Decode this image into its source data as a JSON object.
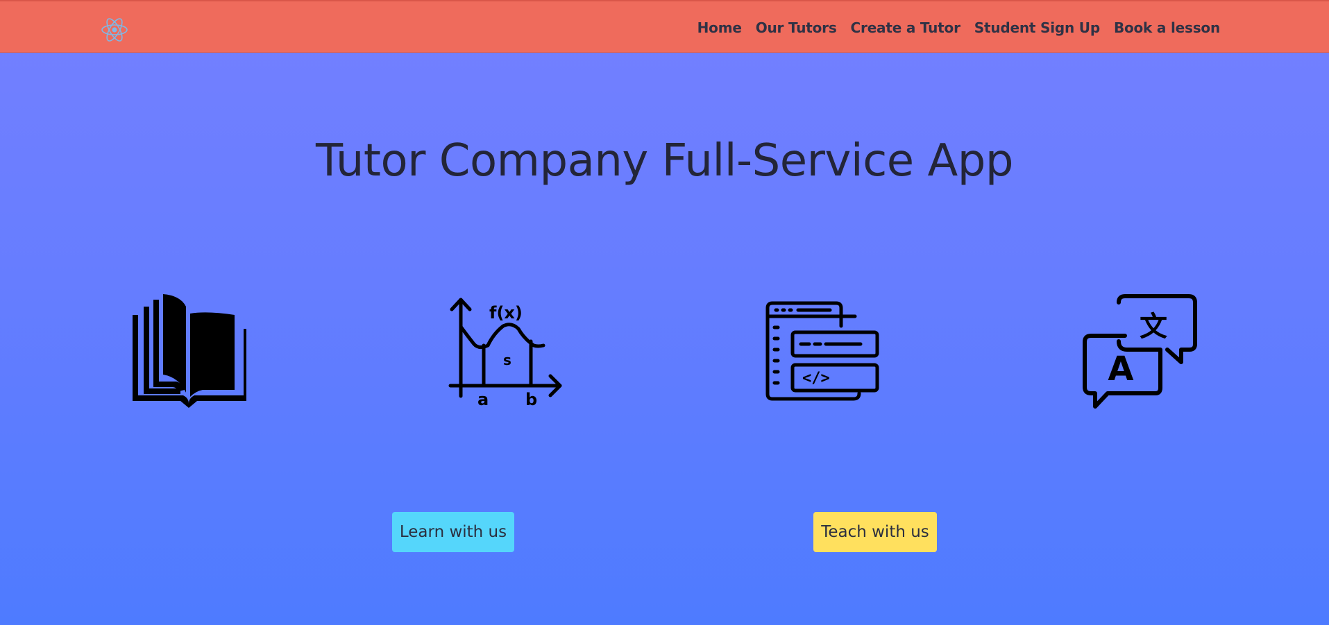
{
  "nav": {
    "brand_icon": "react-atom-icon",
    "links": [
      "Home",
      "Our Tutors",
      "Create a Tutor",
      "Student Sign Up",
      "Book a lesson"
    ]
  },
  "hero": {
    "title": "Tutor Company Full-Service App"
  },
  "subjects": [
    {
      "icon": "open-book-icon"
    },
    {
      "icon": "math-function-graph-icon",
      "labels": {
        "fx": "f(x)",
        "s": "s",
        "a": "a",
        "b": "b"
      }
    },
    {
      "icon": "code-window-icon",
      "code_tag": "</>"
    },
    {
      "icon": "translation-bubbles-icon",
      "labels": {
        "latin": "A",
        "cjk": "文"
      }
    }
  ],
  "actions": {
    "learn_label": "Learn with us",
    "teach_label": "Teach with us"
  },
  "colors": {
    "navbar": "#ef6b5c",
    "gradient_top": "#7480ff",
    "gradient_bottom": "#4e7bff",
    "learn_button": "#55d6fb",
    "teach_button": "#ffe05e",
    "react_logo": "#61dafb"
  }
}
